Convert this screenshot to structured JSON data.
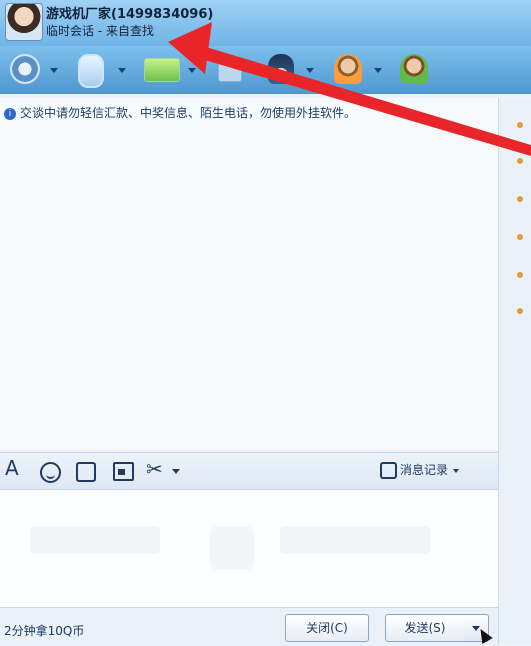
{
  "header": {
    "contact_name": "游戏机厂家(1499834096)",
    "session_status": "临时会话 - 来自查找"
  },
  "chat": {
    "warning_text": "交谈中请勿轻信汇款、中奖信息、陌生电话，勿使用外挂软件。"
  },
  "input_toolbar": {
    "history_label": "消息记录"
  },
  "bottom": {
    "note": "2分钟拿10Q币",
    "close_label": "关闭(C)",
    "send_label": "发送(S)"
  },
  "colors": {
    "annotation_arrow": "#e8262a",
    "titlebar": "#6fb4e6"
  }
}
